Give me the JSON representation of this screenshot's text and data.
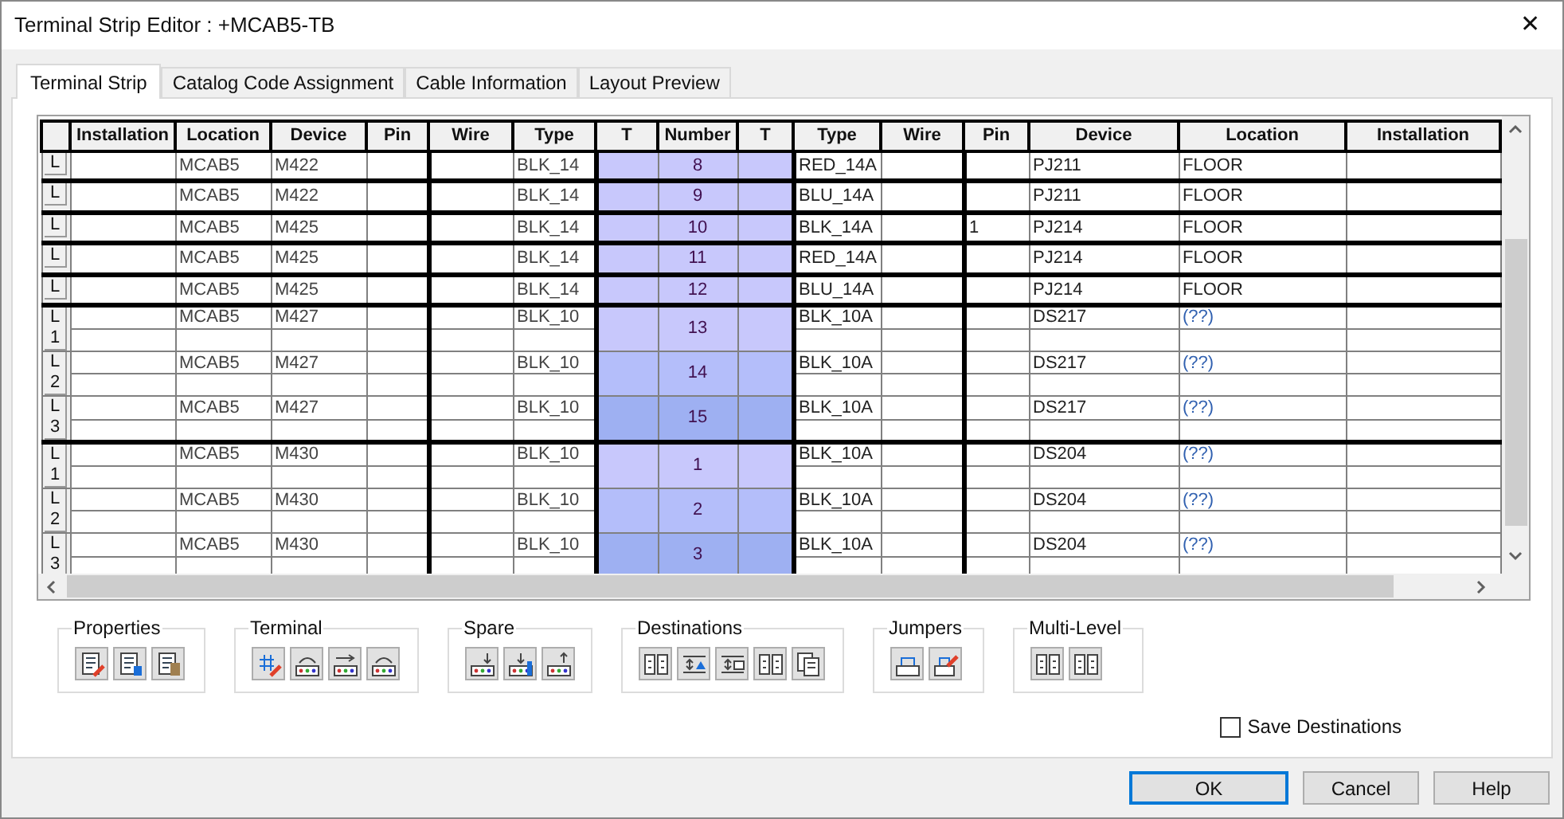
{
  "window": {
    "title": "Terminal Strip Editor : +MCAB5-TB",
    "close": "✕"
  },
  "tabs": [
    {
      "label": "Terminal Strip",
      "selected": true
    },
    {
      "label": "Catalog Code Assignment",
      "selected": false
    },
    {
      "label": "Cable Information",
      "selected": false
    },
    {
      "label": "Layout Preview",
      "selected": false
    }
  ],
  "grid": {
    "columns": [
      "Installation",
      "Location",
      "Device",
      "Pin",
      "Wire",
      "Type",
      "T",
      "Number",
      "T",
      "Type",
      "Wire",
      "Pin",
      "Device",
      "Location",
      "Installation"
    ],
    "groups": [
      {
        "levels": [
          {
            "row_label": "L",
            "left": {
              "location": "MCAB5",
              "device": "M422",
              "type": "BLK_14"
            },
            "number": "8",
            "right": {
              "type": "RED_14A",
              "device": "PJ211",
              "location": "FLOOR"
            },
            "unresolved": false
          }
        ]
      },
      {
        "levels": [
          {
            "row_label": "L",
            "left": {
              "location": "MCAB5",
              "device": "M422",
              "type": "BLK_14"
            },
            "number": "9",
            "right": {
              "type": "BLU_14A",
              "device": "PJ211",
              "location": "FLOOR"
            },
            "unresolved": false
          }
        ]
      },
      {
        "levels": [
          {
            "row_label": "L",
            "left": {
              "location": "MCAB5",
              "device": "M425",
              "type": "BLK_14"
            },
            "number": "10",
            "right": {
              "type": "BLK_14A",
              "pin": "1",
              "device": "PJ214",
              "location": "FLOOR"
            },
            "unresolved": false
          }
        ]
      },
      {
        "levels": [
          {
            "row_label": "L",
            "left": {
              "location": "MCAB5",
              "device": "M425",
              "type": "BLK_14"
            },
            "number": "11",
            "right": {
              "type": "RED_14A",
              "device": "PJ214",
              "location": "FLOOR"
            },
            "unresolved": false
          }
        ]
      },
      {
        "levels": [
          {
            "row_label": "L",
            "left": {
              "location": "MCAB5",
              "device": "M425",
              "type": "BLK_14"
            },
            "number": "12",
            "right": {
              "type": "BLU_14A",
              "device": "PJ214",
              "location": "FLOOR"
            },
            "unresolved": false
          }
        ]
      },
      {
        "levels": [
          {
            "row_label": "L",
            "level_label": "1",
            "left": {
              "location": "MCAB5",
              "device": "M427",
              "type": "BLK_10"
            },
            "number": "13",
            "right": {
              "type": "BLK_10A",
              "device": "DS217",
              "location": "(??)"
            },
            "unresolved": true
          },
          {
            "row_label": "L",
            "level_label": "2",
            "left": {
              "location": "MCAB5",
              "device": "M427",
              "type": "BLK_10"
            },
            "number": "14",
            "right": {
              "type": "BLK_10A",
              "device": "DS217",
              "location": "(??)"
            },
            "unresolved": true
          },
          {
            "row_label": "L",
            "level_label": "3",
            "left": {
              "location": "MCAB5",
              "device": "M427",
              "type": "BLK_10"
            },
            "number": "15",
            "right": {
              "type": "BLK_10A",
              "device": "DS217",
              "location": "(??)"
            },
            "unresolved": true
          }
        ]
      },
      {
        "levels": [
          {
            "row_label": "L",
            "level_label": "1",
            "left": {
              "location": "MCAB5",
              "device": "M430",
              "type": "BLK_10"
            },
            "number": "1",
            "right": {
              "type": "BLK_10A",
              "device": "DS204",
              "location": "(??)"
            },
            "unresolved": true
          },
          {
            "row_label": "L",
            "level_label": "2",
            "left": {
              "location": "MCAB5",
              "device": "M430",
              "type": "BLK_10"
            },
            "number": "2",
            "right": {
              "type": "BLK_10A",
              "device": "DS204",
              "location": "(??)"
            },
            "unresolved": true
          },
          {
            "row_label": "L",
            "level_label": "3",
            "left": {
              "location": "MCAB5",
              "device": "M430",
              "type": "BLK_10"
            },
            "number": "3",
            "right": {
              "type": "BLK_10A",
              "device": "DS204",
              "location": "(??)"
            },
            "unresolved": true
          }
        ]
      }
    ]
  },
  "tool_groups": [
    {
      "label": "Properties"
    },
    {
      "label": "Terminal"
    },
    {
      "label": "Spare"
    },
    {
      "label": "Destinations"
    },
    {
      "label": "Jumpers"
    },
    {
      "label": "Multi-Level"
    }
  ],
  "save_destinations": {
    "label": "Save Destinations",
    "checked": false
  },
  "buttons": [
    {
      "label": "OK",
      "default": true
    },
    {
      "label": "Cancel",
      "default": false
    },
    {
      "label": "Help",
      "default": false
    }
  ]
}
